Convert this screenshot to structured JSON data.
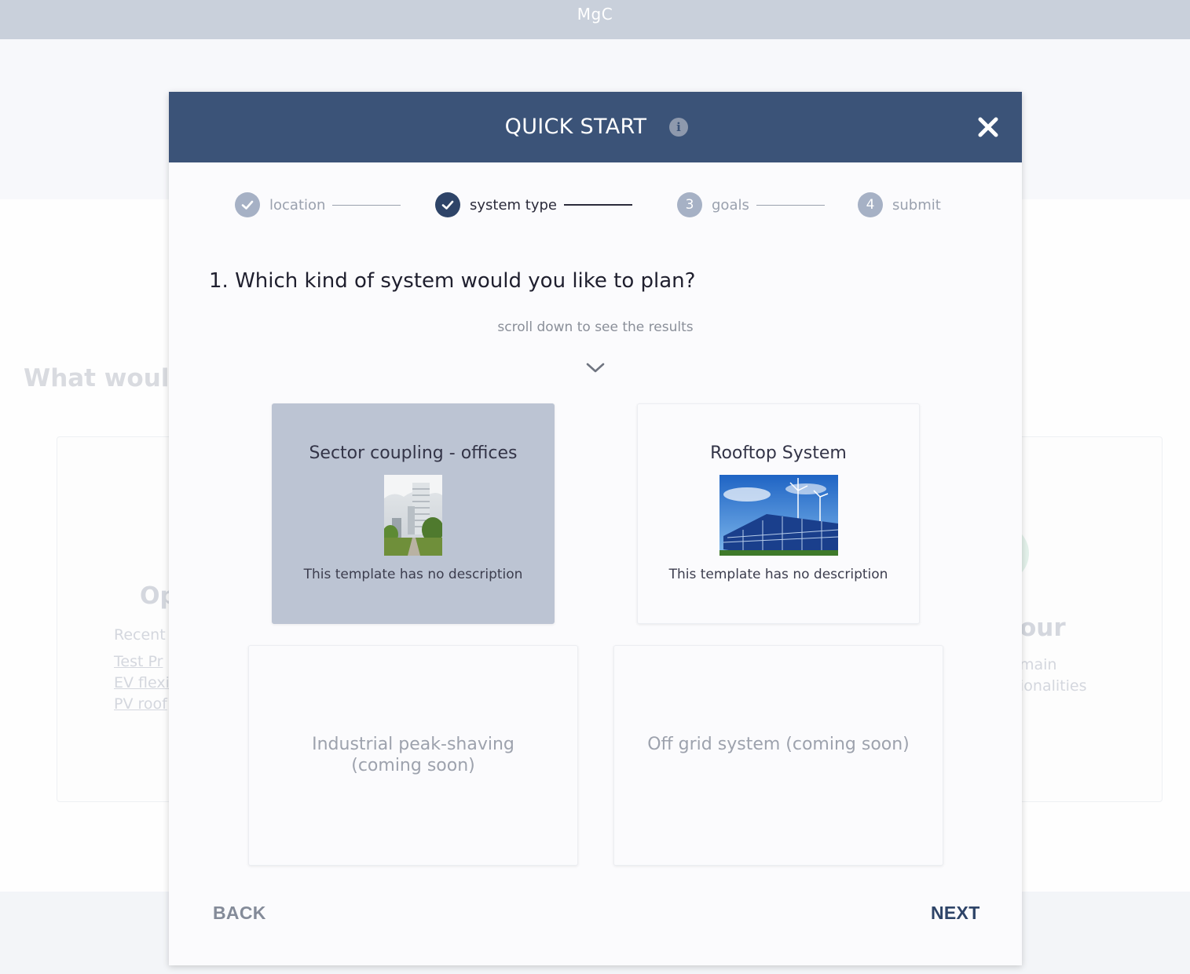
{
  "topbar": {
    "app_name": "MgC"
  },
  "background": {
    "heading": "What would",
    "left_card": {
      "title": "Op",
      "recent_label": "Recent",
      "links": [
        "Test Pr",
        "EV flexi",
        "PV roof"
      ]
    },
    "right_card": {
      "title": "our",
      "lines": [
        "main",
        "ionalities"
      ]
    }
  },
  "modal": {
    "title": "QUICK START",
    "steps": [
      {
        "label": "location",
        "state": "done"
      },
      {
        "label": "system type",
        "state": "active"
      },
      {
        "label": "goals",
        "number": "3",
        "state": "todo"
      },
      {
        "label": "submit",
        "number": "4",
        "state": "todo"
      }
    ],
    "question": "1. Which kind of system would you like to plan?",
    "hint": "scroll down to see the results",
    "templates": [
      {
        "title": "Sector coupling - offices",
        "description": "This template has no description",
        "image": "office-tower-photo",
        "selected": true
      },
      {
        "title": "Rooftop System",
        "description": "This template has no description",
        "image": "solar-panels-wind-turbines-photo",
        "selected": false
      },
      {
        "title": "Industrial peak-shaving (coming soon)",
        "disabled": true
      },
      {
        "title": "Off grid system (coming soon)",
        "disabled": true
      }
    ],
    "back_label": "BACK",
    "next_label": "NEXT"
  },
  "colors": {
    "header": "#3b5378",
    "selected_card": "#bcc4d3",
    "accent": "#2e4468"
  }
}
